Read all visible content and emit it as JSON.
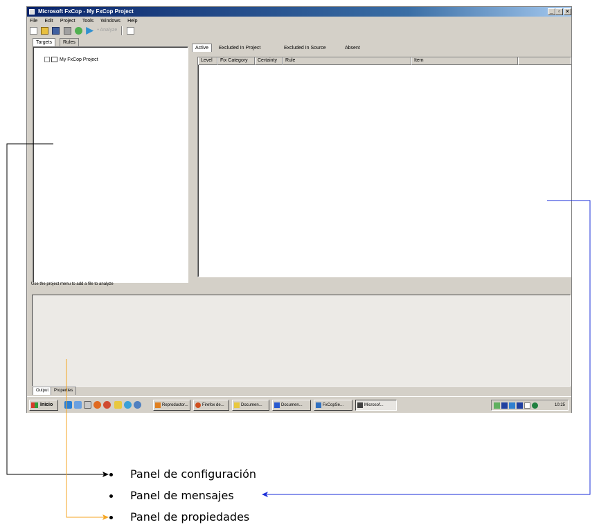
{
  "window": {
    "title": "Microsoft FxCop - My FxCop Project",
    "min_label": "_",
    "max_label": "▫",
    "close_label": "×"
  },
  "menu": [
    "File",
    "Edit",
    "Project",
    "Tools",
    "Windows",
    "Help"
  ],
  "toolbar": {
    "icons": [
      "new-icon",
      "open-icon",
      "save-icon",
      "add-targets-icon",
      "refresh-icon",
      "analyze-icon"
    ],
    "combo_text": "• Analyze",
    "help_icon": "help-icon"
  },
  "left_tabs": [
    {
      "label": "Targets",
      "active": true
    },
    {
      "label": "Rules",
      "active": false
    }
  ],
  "tree": {
    "label": "My FxCop Project"
  },
  "right_tabs": [
    {
      "label": "Active",
      "active": true
    },
    {
      "label": "Excluded In Project",
      "active": false
    },
    {
      "label": "Excluded In Source",
      "active": false
    },
    {
      "label": "Absent",
      "active": false
    }
  ],
  "columns": [
    "Level",
    "Fix Category",
    "Certainty",
    "Rule",
    "Item"
  ],
  "status_text": "Use the project menu to add a file to analyze",
  "bottom_tabs": [
    {
      "label": "Output",
      "active": true
    },
    {
      "label": "Properties",
      "active": false
    }
  ],
  "taskbar": {
    "start_label": "Inicio",
    "quick_launch_icons": [
      "ie-icon",
      "outlook-icon",
      "desktop-icon",
      "media-icon",
      "firefox-icon",
      "explorer-icon",
      "settings-icon",
      "help-icon"
    ],
    "tasks": [
      {
        "label": "Reproductor...",
        "active": false
      },
      {
        "label": "Firefox de...",
        "active": false
      },
      {
        "label": "Documen...",
        "active": false
      },
      {
        "label": "Documen...",
        "active": false
      },
      {
        "label": "FxCopSe...",
        "active": false
      },
      {
        "label": "Microsof...",
        "active": true
      }
    ],
    "clock": "10:25"
  },
  "legend": [
    {
      "label": "Panel de configuración",
      "arrow_color": "#000000"
    },
    {
      "label": "Panel de mensajes",
      "arrow_color": "#1a2ed8"
    },
    {
      "label": "Panel de propiedades",
      "arrow_color": "#f5a623"
    }
  ]
}
